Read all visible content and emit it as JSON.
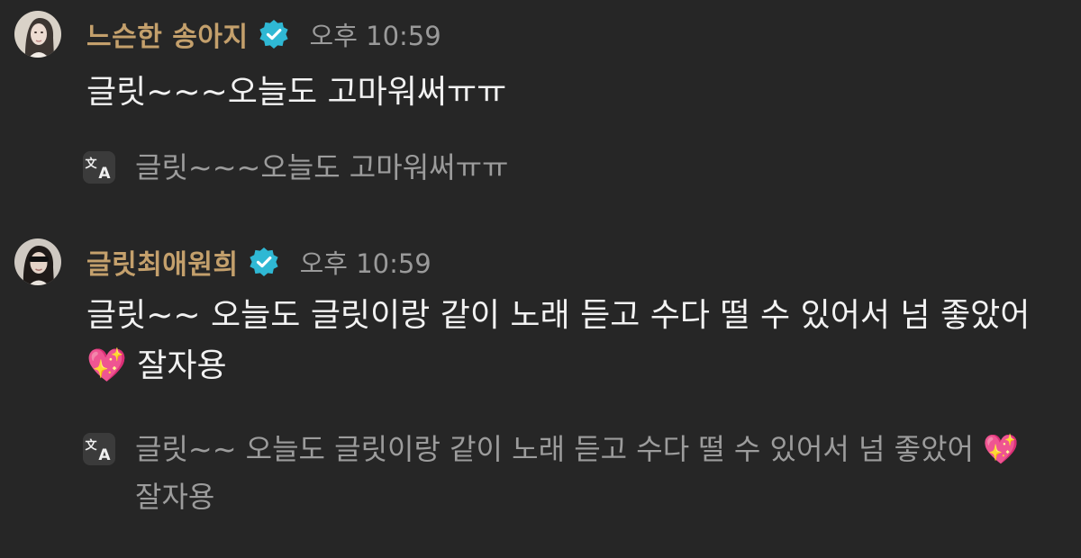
{
  "messages": [
    {
      "author": "느슨한 송아지",
      "time": "오후 10:59",
      "text": "글릿~~~오늘도 고마워써ㅠㅠ",
      "translation": "글릿~~~오늘도 고마워써ㅠㅠ",
      "avatar_icon": "profile-photo",
      "verified_icon": "verified-badge-icon",
      "translate_icon": "translate-icon"
    },
    {
      "author": "글릿최애원희",
      "time": "오후 10:59",
      "text": "글릿~~ 오늘도 글릿이랑 같이 노래 듣고 수다 떨 수 있어서 넘 좋았어 💖 잘자용",
      "translation": "글릿~~ 오늘도 글릿이랑 같이 노래 듣고 수다 떨 수 있어서 넘 좋았어 💖 잘자용",
      "avatar_icon": "profile-photo",
      "verified_icon": "verified-badge-icon",
      "translate_icon": "translate-icon"
    }
  ],
  "colors": {
    "background": "#262626",
    "author": "#c4a06c",
    "time": "#9a9a9a",
    "text": "#f2f2f2",
    "translation": "#9c9c9c",
    "verified_badge": "#2fb8d4"
  }
}
